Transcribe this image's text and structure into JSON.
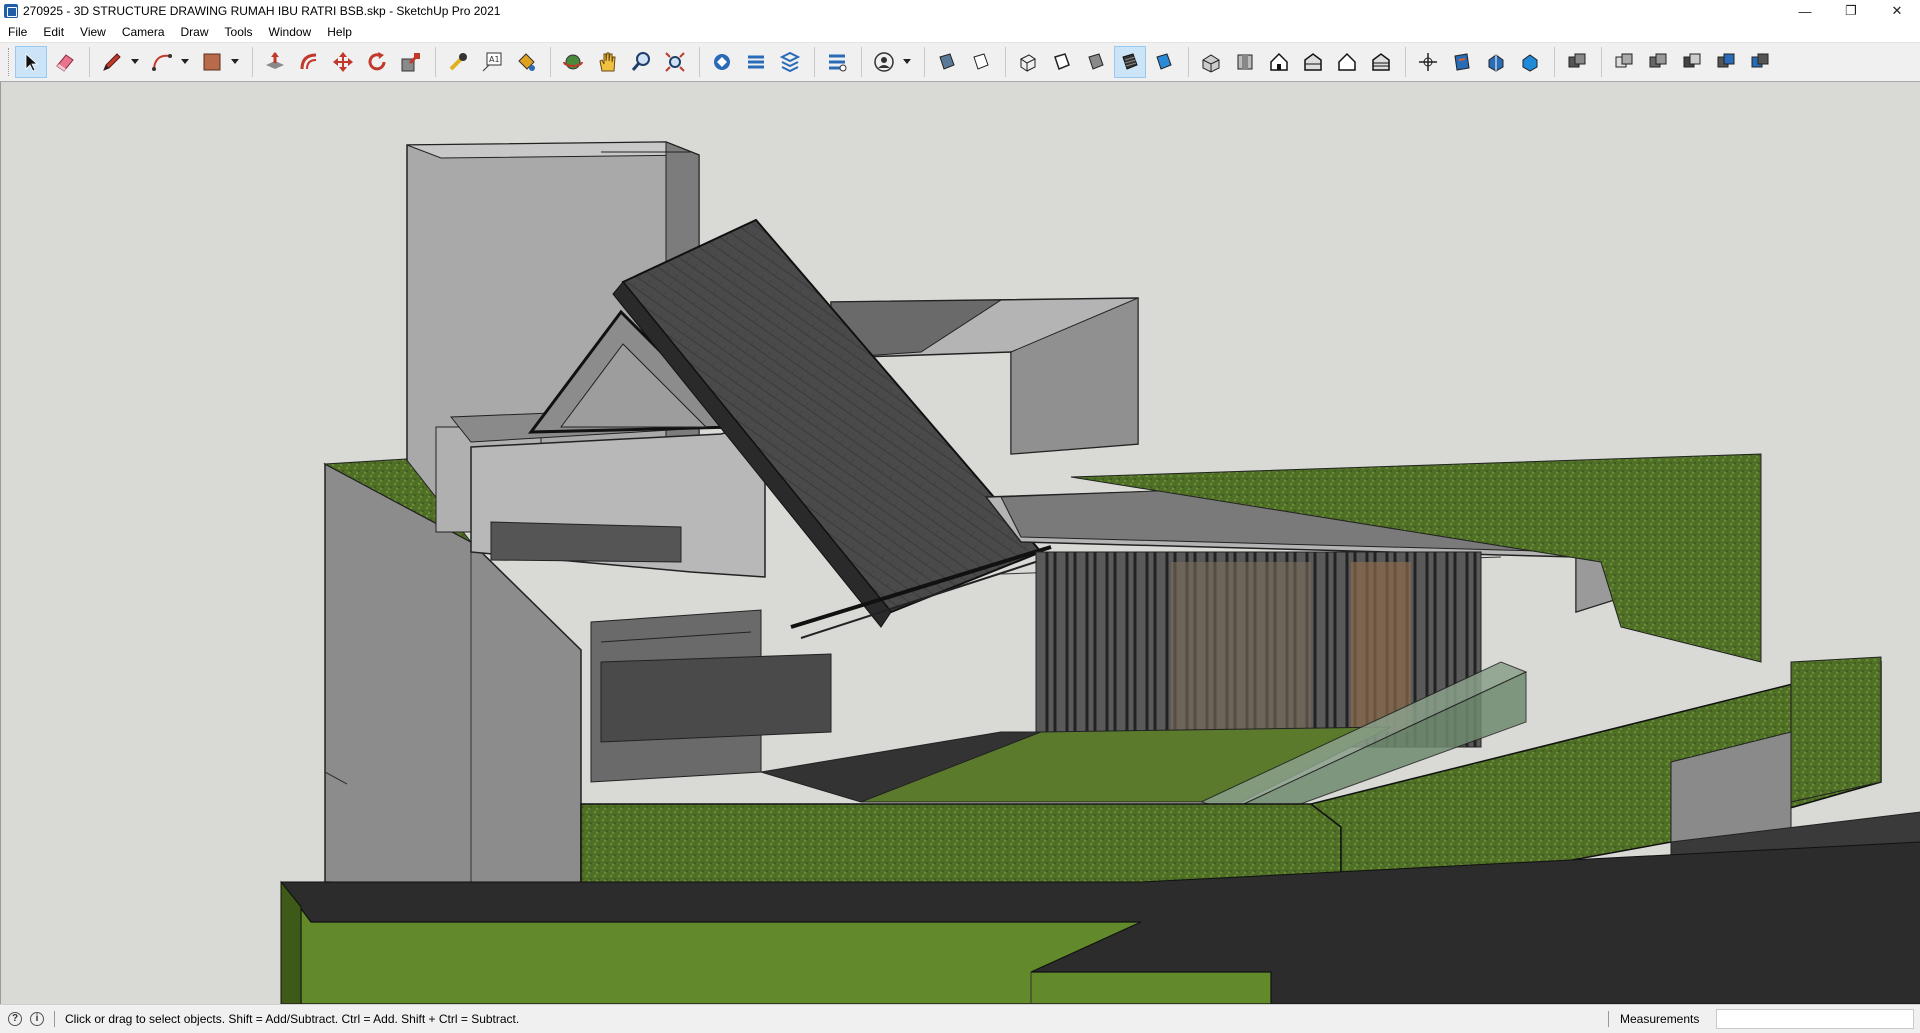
{
  "window": {
    "title": "270925 - 3D STRUCTURE DRAWING RUMAH IBU RATRI BSB.skp - SketchUp Pro 2021",
    "minimize": "—",
    "restore": "❐",
    "close": "✕"
  },
  "menu": [
    "File",
    "Edit",
    "View",
    "Camera",
    "Draw",
    "Tools",
    "Window",
    "Help"
  ],
  "toolbar": {
    "tools": [
      {
        "name": "select-tool",
        "icon": "arrow-cursor-icon",
        "active": true
      },
      {
        "name": "eraser-tool",
        "icon": "eraser-icon"
      },
      {
        "name": "line-tool",
        "icon": "pencil-icon",
        "dropdown": true
      },
      {
        "name": "arc-tool",
        "icon": "arc-icon",
        "dropdown": true
      },
      {
        "name": "rectangle-tool",
        "icon": "rectangle-icon",
        "dropdown": true
      },
      {
        "name": "push-pull-tool",
        "icon": "push-pull-icon"
      },
      {
        "name": "offset-tool",
        "icon": "offset-icon"
      },
      {
        "name": "move-tool",
        "icon": "move-icon"
      },
      {
        "name": "rotate-tool",
        "icon": "rotate-icon"
      },
      {
        "name": "scale-tool",
        "icon": "scale-icon"
      },
      {
        "name": "tape-measure-tool",
        "icon": "tape-measure-icon"
      },
      {
        "name": "text-tool",
        "icon": "text-icon"
      },
      {
        "name": "paint-bucket-tool",
        "icon": "paint-bucket-icon"
      },
      {
        "name": "orbit-tool",
        "icon": "orbit-icon"
      },
      {
        "name": "pan-tool",
        "icon": "hand-icon"
      },
      {
        "name": "zoom-tool",
        "icon": "magnifier-icon"
      },
      {
        "name": "zoom-extents-tool",
        "icon": "zoom-extents-icon"
      }
    ]
  },
  "status": {
    "hint": "Click or drag to select objects. Shift = Add/Subtract. Ctrl = Add. Shift + Ctrl = Subtract.",
    "measurements_label": "Measurements",
    "measurements_value": ""
  },
  "colors": {
    "sky": "#d8d8d8",
    "grass": "#5a7a2a",
    "concrete": "#a9a9a9",
    "roof": "#4a4a4a",
    "road": "#2e2e2e"
  }
}
